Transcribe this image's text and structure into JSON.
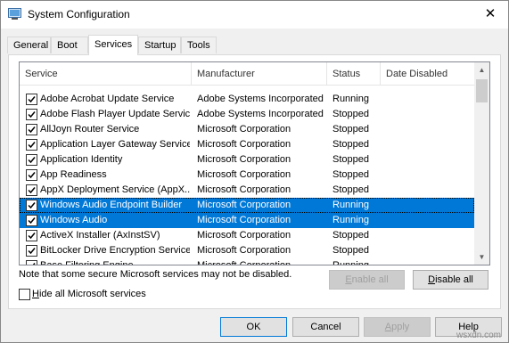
{
  "window": {
    "title": "System Configuration",
    "close_glyph": "✕"
  },
  "tabs": [
    {
      "label": "General",
      "active": false
    },
    {
      "label": "Boot",
      "active": false
    },
    {
      "label": "Services",
      "active": true
    },
    {
      "label": "Startup",
      "active": false
    },
    {
      "label": "Tools",
      "active": false
    }
  ],
  "columns": [
    "Service",
    "Manufacturer",
    "Status",
    "Date Disabled"
  ],
  "rows": [
    {
      "service": "Adobe Acrobat Update Service",
      "manufacturer": "Adobe Systems Incorporated",
      "status": "Running",
      "checked": true,
      "selected": false
    },
    {
      "service": "Adobe Flash Player Update Service",
      "manufacturer": "Adobe Systems Incorporated",
      "status": "Stopped",
      "checked": true,
      "selected": false
    },
    {
      "service": "AllJoyn Router Service",
      "manufacturer": "Microsoft Corporation",
      "status": "Stopped",
      "checked": true,
      "selected": false
    },
    {
      "service": "Application Layer Gateway Service",
      "manufacturer": "Microsoft Corporation",
      "status": "Stopped",
      "checked": true,
      "selected": false
    },
    {
      "service": "Application Identity",
      "manufacturer": "Microsoft Corporation",
      "status": "Stopped",
      "checked": true,
      "selected": false
    },
    {
      "service": "App Readiness",
      "manufacturer": "Microsoft Corporation",
      "status": "Stopped",
      "checked": true,
      "selected": false
    },
    {
      "service": "AppX Deployment Service (AppX...",
      "manufacturer": "Microsoft Corporation",
      "status": "Stopped",
      "checked": true,
      "selected": false
    },
    {
      "service": "Windows Audio Endpoint Builder",
      "manufacturer": "Microsoft Corporation",
      "status": "Running",
      "checked": true,
      "selected": true
    },
    {
      "service": "Windows Audio",
      "manufacturer": "Microsoft Corporation",
      "status": "Running",
      "checked": true,
      "selected": true
    },
    {
      "service": "ActiveX Installer (AxInstSV)",
      "manufacturer": "Microsoft Corporation",
      "status": "Stopped",
      "checked": true,
      "selected": false
    },
    {
      "service": "BitLocker Drive Encryption Service",
      "manufacturer": "Microsoft Corporation",
      "status": "Stopped",
      "checked": true,
      "selected": false
    },
    {
      "service": "Base Filtering Engine",
      "manufacturer": "Microsoft Corporation",
      "status": "Running",
      "checked": true,
      "selected": false
    }
  ],
  "note": "Note that some secure Microsoft services may not be disabled.",
  "buttons": {
    "enable_all": {
      "pre": "",
      "key": "E",
      "post": "nable all"
    },
    "disable_all": {
      "pre": "",
      "key": "D",
      "post": "isable all"
    },
    "ok": "OK",
    "cancel": "Cancel",
    "apply": {
      "pre": "",
      "key": "A",
      "post": "pply"
    },
    "help": "Help"
  },
  "hide_ms": {
    "pre": "",
    "key": "H",
    "post": "ide all Microsoft services",
    "checked": false
  },
  "watermark": "wsxdn.com",
  "colors": {
    "selection": "#0078d7",
    "checkmark": "#000000"
  }
}
